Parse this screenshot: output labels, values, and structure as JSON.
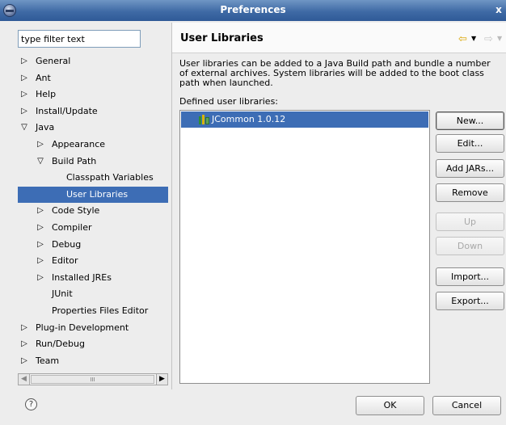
{
  "window": {
    "title": "Preferences",
    "close_glyph": "x"
  },
  "filter": {
    "value": "type filter text"
  },
  "tree": {
    "items": [
      {
        "label": "General",
        "arrow": "▷"
      },
      {
        "label": "Ant",
        "arrow": "▷"
      },
      {
        "label": "Help",
        "arrow": "▷"
      },
      {
        "label": "Install/Update",
        "arrow": "▷"
      },
      {
        "label": "Java",
        "arrow": "▽"
      },
      {
        "label": "Appearance",
        "arrow": "▷"
      },
      {
        "label": "Build Path",
        "arrow": "▽"
      },
      {
        "label": "Classpath Variables"
      },
      {
        "label": "User Libraries",
        "selected": true
      },
      {
        "label": "Code Style",
        "arrow": "▷"
      },
      {
        "label": "Compiler",
        "arrow": "▷"
      },
      {
        "label": "Debug",
        "arrow": "▷"
      },
      {
        "label": "Editor",
        "arrow": "▷"
      },
      {
        "label": "Installed JREs",
        "arrow": "▷"
      },
      {
        "label": "JUnit"
      },
      {
        "label": "Properties Files Editor"
      },
      {
        "label": "Plug-in Development",
        "arrow": "▷"
      },
      {
        "label": "Run/Debug",
        "arrow": "▷"
      },
      {
        "label": "Team",
        "arrow": "▷"
      }
    ],
    "scroll_thumb_glyph": "III"
  },
  "page": {
    "title": "User Libraries",
    "description": "User libraries can be added to a Java Build path and bundle a number of external archives. System libraries will be added to the boot class path when launched.",
    "defined_label": "Defined user libraries:",
    "libraries": [
      "JCommon 1.0.12"
    ]
  },
  "buttons": {
    "new": "New...",
    "edit": "Edit...",
    "add_jars": "Add JARs...",
    "remove": "Remove",
    "up": "Up",
    "down": "Down",
    "import": "Import...",
    "export": "Export..."
  },
  "footer": {
    "ok": "OK",
    "cancel": "Cancel",
    "help_glyph": "?"
  },
  "colors": {
    "selection": "#3d6db5",
    "title_bar": "#3f6aa5"
  }
}
